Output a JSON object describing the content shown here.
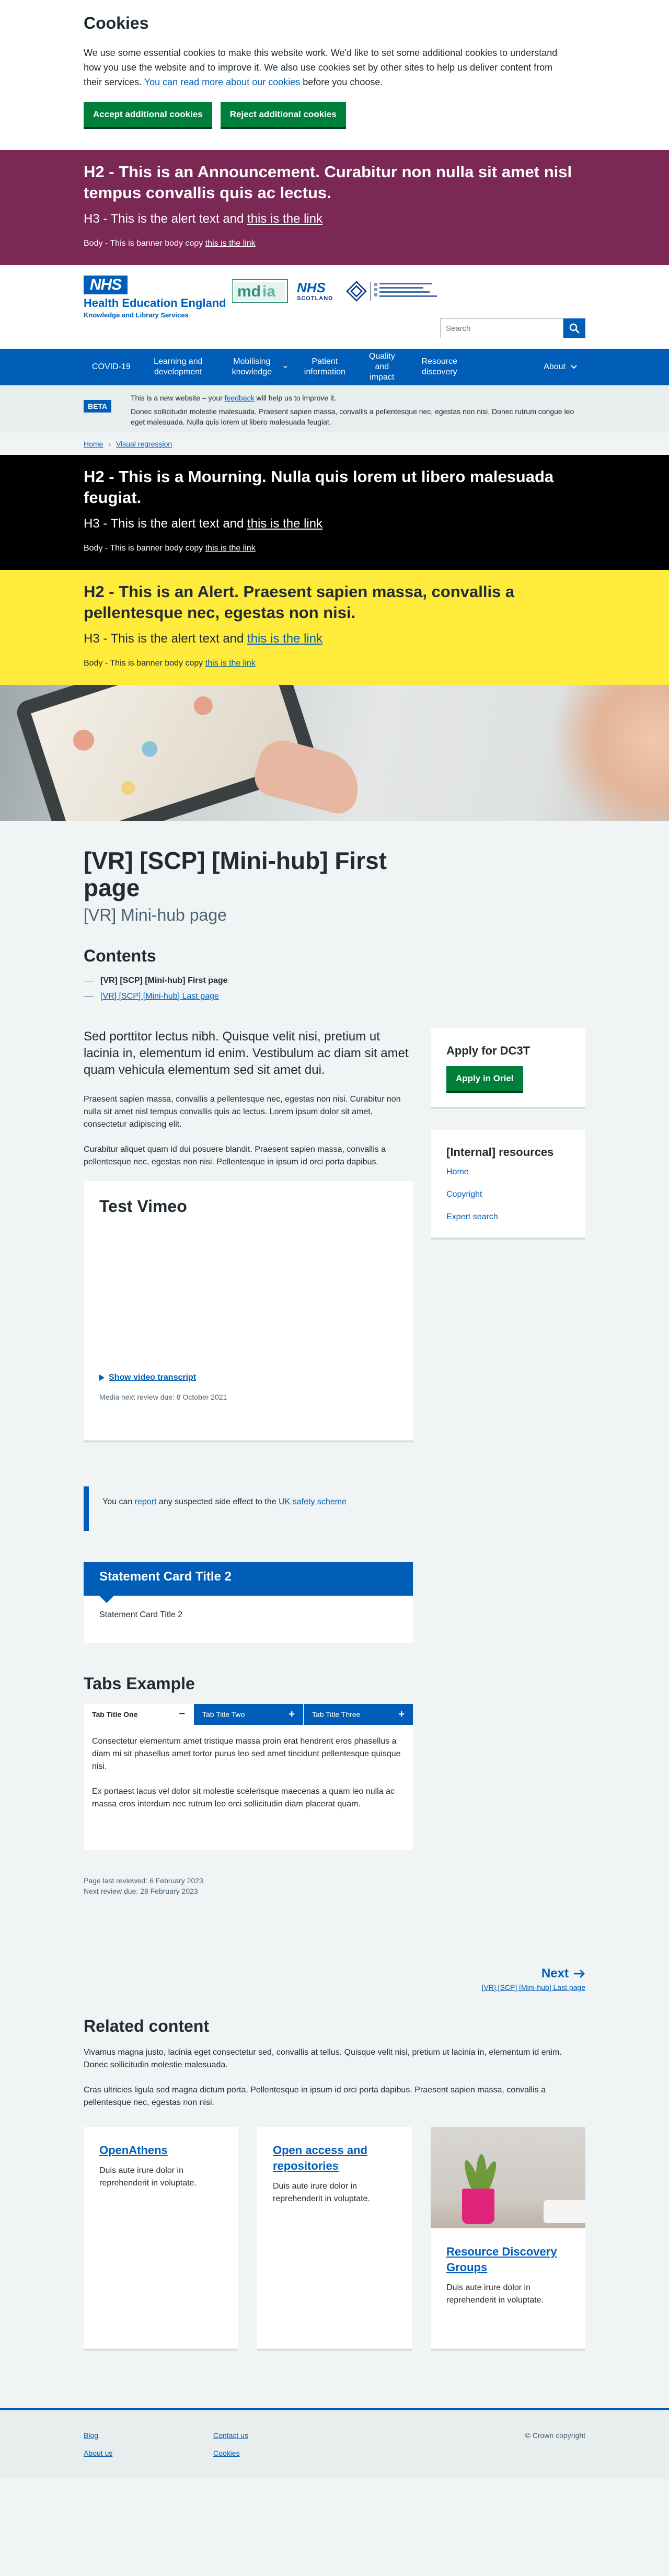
{
  "cookies": {
    "title": "Cookies",
    "text_before": "We use some essential cookies to make this website work. We'd like to set some additional cookies to understand how you use the website and to improve it. We also use cookies set by other sites to help us deliver content from their services. ",
    "link": "You can read more about our cookies",
    "text_after": " before you choose.",
    "accept_label": "Accept additional cookies",
    "reject_label": "Reject additional cookies"
  },
  "announcement": {
    "h2": "H2 - This is an Announcement. Curabitur non nulla sit amet nisl tempus convallis quis ac lectus.",
    "h3_text": "H3 - This is the alert text and ",
    "h3_link": "this is the link",
    "body_text": "Body - This is banner body copy ",
    "body_link": "this is the link"
  },
  "header": {
    "nhs": "NHS",
    "org_title": "Health Education England",
    "org_sub": "Knowledge and Library Services",
    "partner2_nhs": "NHS",
    "partner2_sub": "SCOTLAND",
    "search_placeholder": "Search"
  },
  "nav": [
    "COVID-19",
    "Learning and development",
    "Mobilising knowledge",
    "Patient information",
    "Quality and impact",
    "Resource discovery",
    "About"
  ],
  "beta": {
    "tag": "BETA",
    "line1_before": "This is a new website – your ",
    "line1_link": "feedback",
    "line1_after": " will help us to improve it.",
    "line2": "Donec sollicitudin molestie malesuada. Praesent sapien massa, convallis a pellentesque nec, egestas non nisi. Donec rutrum congue leo eget malesuada. Nulla quis lorem ut libero malesuada feugiat."
  },
  "breadcrumb": [
    "Home",
    "Visual regression"
  ],
  "mourning": {
    "h2": "H2 - This is a Mourning. Nulla quis lorem ut libero malesuada feugiat.",
    "h3_text": "H3 - This is the alert text and ",
    "h3_link": "this is the link",
    "body_text": "Body - This is banner body copy ",
    "body_link": "this is the link"
  },
  "alert": {
    "h2": "H2 - This is an Alert. Praesent sapien massa, convallis a pellentesque nec, egestas non nisi.",
    "h3_text": "H3 - This is the alert text and ",
    "h3_link": "this is the link",
    "body_text": "Body - This is banner body copy ",
    "body_link": "this is the link"
  },
  "page": {
    "title": "[VR] [SCP] [Mini-hub] First page",
    "caption": "[VR] Mini-hub page"
  },
  "contents": {
    "title": "Contents",
    "current": "[VR] [SCP] [Mini-hub] First page",
    "link": "[VR] [SCP] [Mini-hub] Last page"
  },
  "body": {
    "lede": "Sed porttitor lectus nibh. Quisque velit nisi, pretium ut lacinia in, elementum id enim. Vestibulum ac diam sit amet quam vehicula elementum sed sit amet dui.",
    "p1": "Praesent sapien massa, convallis a pellentesque nec, egestas non nisi. Curabitur non nulla sit amet nisl tempus convallis quis ac lectus. Lorem ipsum dolor sit amet, consectetur adipiscing elit.",
    "p2": "Curabitur aliquet quam id dui posuere blandit. Praesent sapien massa, convallis a pellentesque nec, egestas non nisi. Pellentesque in ipsum id orci porta dapibus."
  },
  "vimeo": {
    "title": "Test Vimeo",
    "transcript": "Show video transcript",
    "review": "Media next review due: 8 October 2021"
  },
  "inset": {
    "before": "You can ",
    "link1": "report",
    "middle": " any suspected side effect to the ",
    "link2": "UK safety scheme"
  },
  "statement": {
    "title": "Statement Card Title 2",
    "body": "Statement Card Title 2"
  },
  "tabs": {
    "title": "Tabs Example",
    "items": [
      "Tab Title One",
      "Tab Title Two",
      "Tab Title Three"
    ],
    "p1": "Consectetur elementum amet tristique massa proin erat hendrerit eros phasellus a diam mi sit phasellus amet tortor purus leo sed amet tincidunt pellentesque quisque nisi.",
    "p2": "Ex portaest lacus vel dolor sit molestie scelerisque maecenas a quam leo nulla ac massa eros interdum nec rutrum leo orci sollicitudin diam placerat quam."
  },
  "reviewed": {
    "last": "Page last reviewed: 6 February 2023",
    "next": "Next review due: 28 February 2023"
  },
  "sidebar": {
    "apply_title": "Apply for DC3T",
    "apply_button": "Apply in Oriel",
    "resources_title": "[Internal] resources",
    "links": [
      "Home",
      "Copyright",
      "Expert search"
    ]
  },
  "pager": {
    "label": "Next",
    "page": "[VR] [SCP] [Mini-hub] Last page"
  },
  "related": {
    "title": "Related content",
    "p1": "Vivamus magna justo, lacinia eget consectetur sed, convallis at tellus. Quisque velit nisi, pretium ut lacinia in, elementum id enim. Donec sollicitudin molestie malesuada.",
    "p2": "Cras ultricies ligula sed magna dictum porta. Pellentesque in ipsum id orci porta dapibus. Praesent sapien massa, convallis a pellentesque nec, egestas non nisi.",
    "cards": [
      {
        "title": "OpenAthens",
        "text": "Duis aute irure dolor in reprehenderit in voluptate."
      },
      {
        "title": "Open access and repositories",
        "text": "Duis aute irure dolor in reprehenderit in voluptate."
      },
      {
        "title": "Resource Discovery Groups",
        "text": "Duis aute irure dolor in reprehenderit in voluptate."
      }
    ]
  },
  "footer": {
    "col1": [
      "Blog",
      "About us"
    ],
    "col2": [
      "Contact us",
      "Cookies"
    ],
    "copyright": "© Crown copyright"
  },
  "colors": {
    "nhs_blue": "#005eb8",
    "green": "#007f3b",
    "plum": "#7c2855",
    "yellow": "#ffeb3b"
  }
}
